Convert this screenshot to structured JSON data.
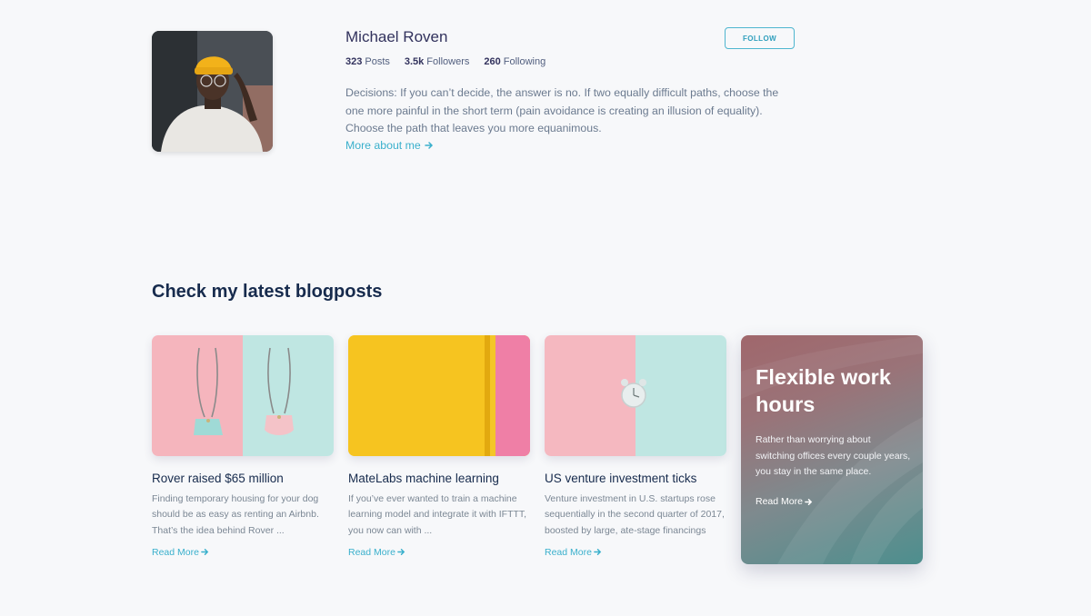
{
  "profile": {
    "name": "Michael Roven",
    "follow_label": "FOLLOW",
    "stats": [
      {
        "value": "323",
        "label": "Posts"
      },
      {
        "value": "3.5k",
        "label": "Followers"
      },
      {
        "value": "260",
        "label": "Following"
      }
    ],
    "bio": "Decisions: If you can’t decide, the answer is no. If two equally difficult paths, choose the one more painful in the short term (pain avoidance is creating an illusion of equality). Choose the path that leaves you more equanimous.",
    "more_link": "More about me"
  },
  "blog": {
    "section_title": "Check my latest blogposts",
    "posts": [
      {
        "title": "Rover raised $65 million",
        "excerpt": "Finding temporary housing for your dog should be as easy as renting an Airbnb. That’s the idea behind Rover ...",
        "read_more": "Read More",
        "image_icon": "handbags-photo"
      },
      {
        "title": "MateLabs machine learning",
        "excerpt": "If you’ve ever wanted to train a machine learning model and integrate it with IFTTT, you now can with ...",
        "read_more": "Read More",
        "image_icon": "yellow-paper-photo"
      },
      {
        "title": "US venture investment ticks",
        "excerpt": "Venture investment in U.S. startups rose sequentially in the second quarter of 2017, boosted by large, ate-stage financings",
        "read_more": "Read More",
        "image_icon": "alarm-clock-photo"
      }
    ],
    "feature": {
      "title": "Flexible work hours",
      "text": "Rather than worrying about switching offices every couple years, you stay in the same place.",
      "read_more": "Read More"
    }
  },
  "colors": {
    "accent": "#3ab0cc",
    "background": "#f7f8fa",
    "heading": "#172b4d",
    "pink": "#f5b8c0",
    "mint": "#bfe6e2",
    "yellow": "#f6c21c"
  },
  "icons": {
    "arrow": "arrow-right-icon"
  }
}
